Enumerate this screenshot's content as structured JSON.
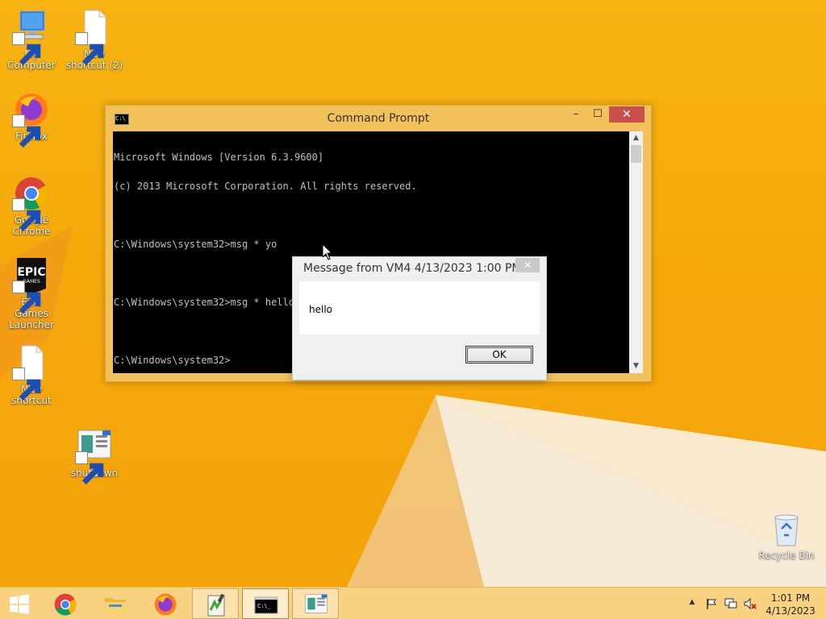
{
  "desktop": {
    "icons": [
      {
        "label": "My Computer",
        "icon": "computer-icon"
      },
      {
        "label": "New shortcut (2)",
        "icon": "blank-file-icon"
      },
      {
        "label": "Firefox",
        "icon": "firefox-icon"
      },
      {
        "label": "Google Chrome",
        "icon": "chrome-icon"
      },
      {
        "label": "Epic Games Launcher",
        "icon": "epic-games-icon"
      },
      {
        "label": "New shortcut",
        "icon": "blank-file-icon"
      },
      {
        "label": "shutdown",
        "icon": "shutdown-icon"
      },
      {
        "label": "Recycle Bin",
        "icon": "recycle-bin-icon"
      }
    ],
    "epic_logo_text": "EPIC",
    "epic_logo_sub": "GAMES"
  },
  "cmd_window": {
    "title": "Command Prompt",
    "icon_text": "C:\\",
    "minimize_glyph": "–",
    "maximize_glyph": "☐",
    "close_glyph": "✕",
    "lines": [
      "Microsoft Windows [Version 6.3.9600]",
      "(c) 2013 Microsoft Corporation. All rights reserved.",
      "",
      "C:\\Windows\\system32>msg * yo",
      "",
      "C:\\Windows\\system32>msg * hello",
      "",
      "C:\\Windows\\system32>"
    ],
    "scroll_up_glyph": "▲",
    "scroll_down_glyph": "▼"
  },
  "message_dialog": {
    "title": "Message from VM4 4/13/2023 1:00 PM",
    "close_glyph": "✕",
    "text": "hello",
    "ok_label": "OK"
  },
  "taskbar": {
    "buttons": [
      {
        "icon": "windows-start-icon",
        "state": "normal"
      },
      {
        "icon": "chrome-icon",
        "state": "normal"
      },
      {
        "icon": "file-explorer-icon",
        "state": "normal"
      },
      {
        "icon": "firefox-icon",
        "state": "normal"
      },
      {
        "icon": "notepad-plus-plus-icon",
        "state": "open"
      },
      {
        "icon": "command-prompt-icon",
        "state": "active"
      },
      {
        "icon": "shutdown-icon",
        "state": "open"
      }
    ],
    "cmd_icon_text": "C:\\_",
    "tray": {
      "icons": [
        "show-hidden-icons-chevron-icon",
        "action-center-flag-icon",
        "network-icon",
        "volume-muted-icon"
      ],
      "chevron_glyph": "▲"
    },
    "clock": {
      "time": "1:01 PM",
      "date": "4/13/2023"
    }
  },
  "colors": {
    "wallpaper": "#f5a90b",
    "close_red": "#c7504a",
    "cmd_frame": "#f2c15a",
    "console_bg": "#000000",
    "console_fg": "#c0c0c0"
  }
}
